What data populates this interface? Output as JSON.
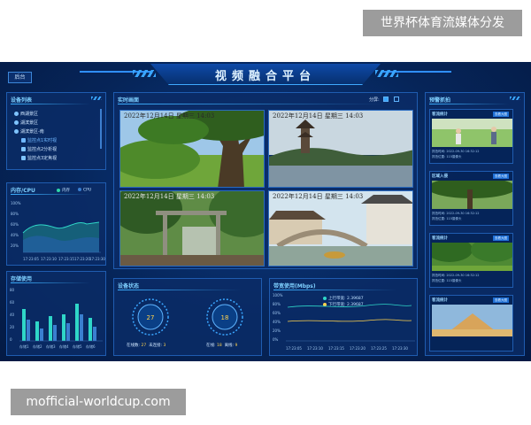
{
  "watermark_top": "世界杯体育流媒体分发",
  "watermark_bottom": "mofficial-worldcup.com",
  "header": {
    "title": "视频融合平台",
    "back_label": "后台"
  },
  "device_list": {
    "title": "设备列表",
    "items": [
      {
        "label": "西湖景区",
        "level": 0,
        "active": false
      },
      {
        "label": "湖滨景区",
        "level": 0,
        "active": false
      },
      {
        "label": "湖滨景区-南",
        "level": 0,
        "active": false
      },
      {
        "label": "监控点1实时视",
        "level": 1,
        "active": true
      },
      {
        "label": "监控点2分析视",
        "level": 1,
        "active": false
      },
      {
        "label": "监控点3定焦视",
        "level": 1,
        "active": false
      }
    ]
  },
  "memory_cpu": {
    "title": "内存/CPU",
    "legend": [
      "内存",
      "CPU"
    ],
    "y_ticks": [
      "100%",
      "80%",
      "60%",
      "40%",
      "20%"
    ],
    "x_ticks": [
      "17:23:05",
      "17:23:10",
      "17:23:15",
      "17:23:20",
      "17:23:30"
    ]
  },
  "storage": {
    "title": "存储使用",
    "y_ticks": [
      "80",
      "60",
      "40",
      "20",
      "0"
    ],
    "x_ticks": [
      "存储1",
      "存储2",
      "存储3",
      "存储4",
      "存储5",
      "存储6"
    ]
  },
  "realtime": {
    "title": "实时画面",
    "split_label": "分屏:",
    "timestamps": [
      "2022年12月14日 星期三 14:03",
      "2022年12月14日 星期三 14:03",
      "2022年12月14日 星期三 14:03",
      "2022年12月14日 星期三 14:03"
    ]
  },
  "device_status": {
    "title": "设备状态",
    "gauges": [
      {
        "value": "27",
        "label1": "在线数",
        "val1": "27",
        "label2": "未连接",
        "val2": "3"
      },
      {
        "value": "18",
        "label1": "在线",
        "val1": "18",
        "label2": "离线",
        "val2": "9"
      }
    ]
  },
  "bandwidth": {
    "title": "带宽使用(Mbps)",
    "legend": [
      {
        "name": "上行带宽",
        "value": "2.39687"
      },
      {
        "name": "下行带宽",
        "value": "2.39687"
      }
    ],
    "y_ticks": [
      "100%",
      "80%",
      "60%",
      "40%",
      "20%",
      "0%"
    ],
    "x_ticks": [
      "17:23:05",
      "17:23:10",
      "17:23:15",
      "17:23:20",
      "17:23:25",
      "17:23:30"
    ]
  },
  "alerts": {
    "title": "预警抓拍",
    "items": [
      {
        "title": "客流统计",
        "btn": "查看大图",
        "time_label": "抓拍时间:",
        "time": "2022-09-30 16:32:12",
        "loc_label": "抓拍位置:",
        "loc": "115摄像头"
      },
      {
        "title": "区域入侵",
        "btn": "查看大图",
        "time_label": "抓拍时间:",
        "time": "2022-09-30 16:32:12",
        "loc_label": "抓拍位置:",
        "loc": "115摄像头"
      },
      {
        "title": "客流统计",
        "btn": "查看大图",
        "time_label": "抓拍时间:",
        "time": "2022-09-30 16:32:12",
        "loc_label": "抓拍位置:",
        "loc": "115摄像头"
      },
      {
        "title": "客流统计",
        "btn": "查看大图"
      }
    ]
  },
  "colors": {
    "accent": "#3aa6ff",
    "gauge_yellow": "#ffd24d",
    "line_teal": "#2fd6c8"
  }
}
